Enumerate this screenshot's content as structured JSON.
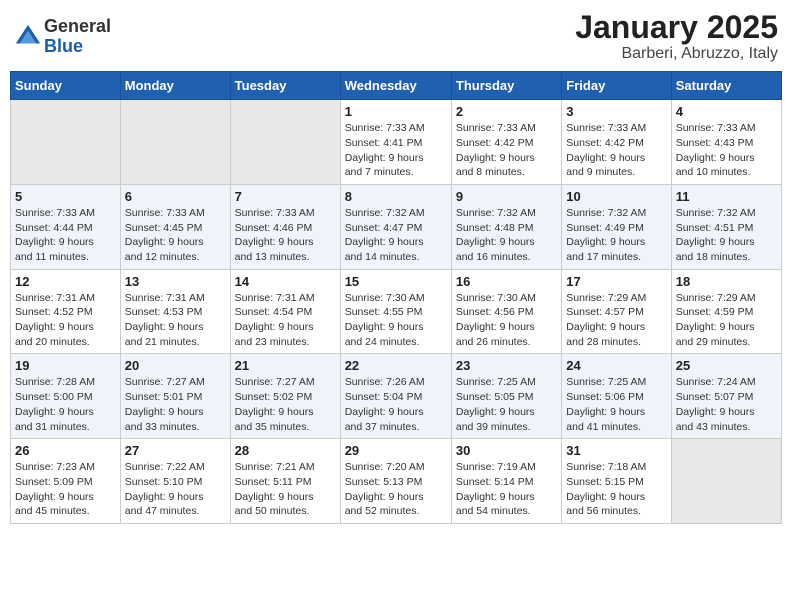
{
  "header": {
    "logo": {
      "general": "General",
      "blue": "Blue"
    },
    "month": "January 2025",
    "location": "Barberi, Abruzzo, Italy"
  },
  "weekdays": [
    "Sunday",
    "Monday",
    "Tuesday",
    "Wednesday",
    "Thursday",
    "Friday",
    "Saturday"
  ],
  "weeks": [
    [
      {
        "day": "",
        "info": ""
      },
      {
        "day": "",
        "info": ""
      },
      {
        "day": "",
        "info": ""
      },
      {
        "day": "1",
        "info": "Sunrise: 7:33 AM\nSunset: 4:41 PM\nDaylight: 9 hours\nand 7 minutes."
      },
      {
        "day": "2",
        "info": "Sunrise: 7:33 AM\nSunset: 4:42 PM\nDaylight: 9 hours\nand 8 minutes."
      },
      {
        "day": "3",
        "info": "Sunrise: 7:33 AM\nSunset: 4:42 PM\nDaylight: 9 hours\nand 9 minutes."
      },
      {
        "day": "4",
        "info": "Sunrise: 7:33 AM\nSunset: 4:43 PM\nDaylight: 9 hours\nand 10 minutes."
      }
    ],
    [
      {
        "day": "5",
        "info": "Sunrise: 7:33 AM\nSunset: 4:44 PM\nDaylight: 9 hours\nand 11 minutes."
      },
      {
        "day": "6",
        "info": "Sunrise: 7:33 AM\nSunset: 4:45 PM\nDaylight: 9 hours\nand 12 minutes."
      },
      {
        "day": "7",
        "info": "Sunrise: 7:33 AM\nSunset: 4:46 PM\nDaylight: 9 hours\nand 13 minutes."
      },
      {
        "day": "8",
        "info": "Sunrise: 7:32 AM\nSunset: 4:47 PM\nDaylight: 9 hours\nand 14 minutes."
      },
      {
        "day": "9",
        "info": "Sunrise: 7:32 AM\nSunset: 4:48 PM\nDaylight: 9 hours\nand 16 minutes."
      },
      {
        "day": "10",
        "info": "Sunrise: 7:32 AM\nSunset: 4:49 PM\nDaylight: 9 hours\nand 17 minutes."
      },
      {
        "day": "11",
        "info": "Sunrise: 7:32 AM\nSunset: 4:51 PM\nDaylight: 9 hours\nand 18 minutes."
      }
    ],
    [
      {
        "day": "12",
        "info": "Sunrise: 7:31 AM\nSunset: 4:52 PM\nDaylight: 9 hours\nand 20 minutes."
      },
      {
        "day": "13",
        "info": "Sunrise: 7:31 AM\nSunset: 4:53 PM\nDaylight: 9 hours\nand 21 minutes."
      },
      {
        "day": "14",
        "info": "Sunrise: 7:31 AM\nSunset: 4:54 PM\nDaylight: 9 hours\nand 23 minutes."
      },
      {
        "day": "15",
        "info": "Sunrise: 7:30 AM\nSunset: 4:55 PM\nDaylight: 9 hours\nand 24 minutes."
      },
      {
        "day": "16",
        "info": "Sunrise: 7:30 AM\nSunset: 4:56 PM\nDaylight: 9 hours\nand 26 minutes."
      },
      {
        "day": "17",
        "info": "Sunrise: 7:29 AM\nSunset: 4:57 PM\nDaylight: 9 hours\nand 28 minutes."
      },
      {
        "day": "18",
        "info": "Sunrise: 7:29 AM\nSunset: 4:59 PM\nDaylight: 9 hours\nand 29 minutes."
      }
    ],
    [
      {
        "day": "19",
        "info": "Sunrise: 7:28 AM\nSunset: 5:00 PM\nDaylight: 9 hours\nand 31 minutes."
      },
      {
        "day": "20",
        "info": "Sunrise: 7:27 AM\nSunset: 5:01 PM\nDaylight: 9 hours\nand 33 minutes."
      },
      {
        "day": "21",
        "info": "Sunrise: 7:27 AM\nSunset: 5:02 PM\nDaylight: 9 hours\nand 35 minutes."
      },
      {
        "day": "22",
        "info": "Sunrise: 7:26 AM\nSunset: 5:04 PM\nDaylight: 9 hours\nand 37 minutes."
      },
      {
        "day": "23",
        "info": "Sunrise: 7:25 AM\nSunset: 5:05 PM\nDaylight: 9 hours\nand 39 minutes."
      },
      {
        "day": "24",
        "info": "Sunrise: 7:25 AM\nSunset: 5:06 PM\nDaylight: 9 hours\nand 41 minutes."
      },
      {
        "day": "25",
        "info": "Sunrise: 7:24 AM\nSunset: 5:07 PM\nDaylight: 9 hours\nand 43 minutes."
      }
    ],
    [
      {
        "day": "26",
        "info": "Sunrise: 7:23 AM\nSunset: 5:09 PM\nDaylight: 9 hours\nand 45 minutes."
      },
      {
        "day": "27",
        "info": "Sunrise: 7:22 AM\nSunset: 5:10 PM\nDaylight: 9 hours\nand 47 minutes."
      },
      {
        "day": "28",
        "info": "Sunrise: 7:21 AM\nSunset: 5:11 PM\nDaylight: 9 hours\nand 50 minutes."
      },
      {
        "day": "29",
        "info": "Sunrise: 7:20 AM\nSunset: 5:13 PM\nDaylight: 9 hours\nand 52 minutes."
      },
      {
        "day": "30",
        "info": "Sunrise: 7:19 AM\nSunset: 5:14 PM\nDaylight: 9 hours\nand 54 minutes."
      },
      {
        "day": "31",
        "info": "Sunrise: 7:18 AM\nSunset: 5:15 PM\nDaylight: 9 hours\nand 56 minutes."
      },
      {
        "day": "",
        "info": ""
      }
    ]
  ]
}
